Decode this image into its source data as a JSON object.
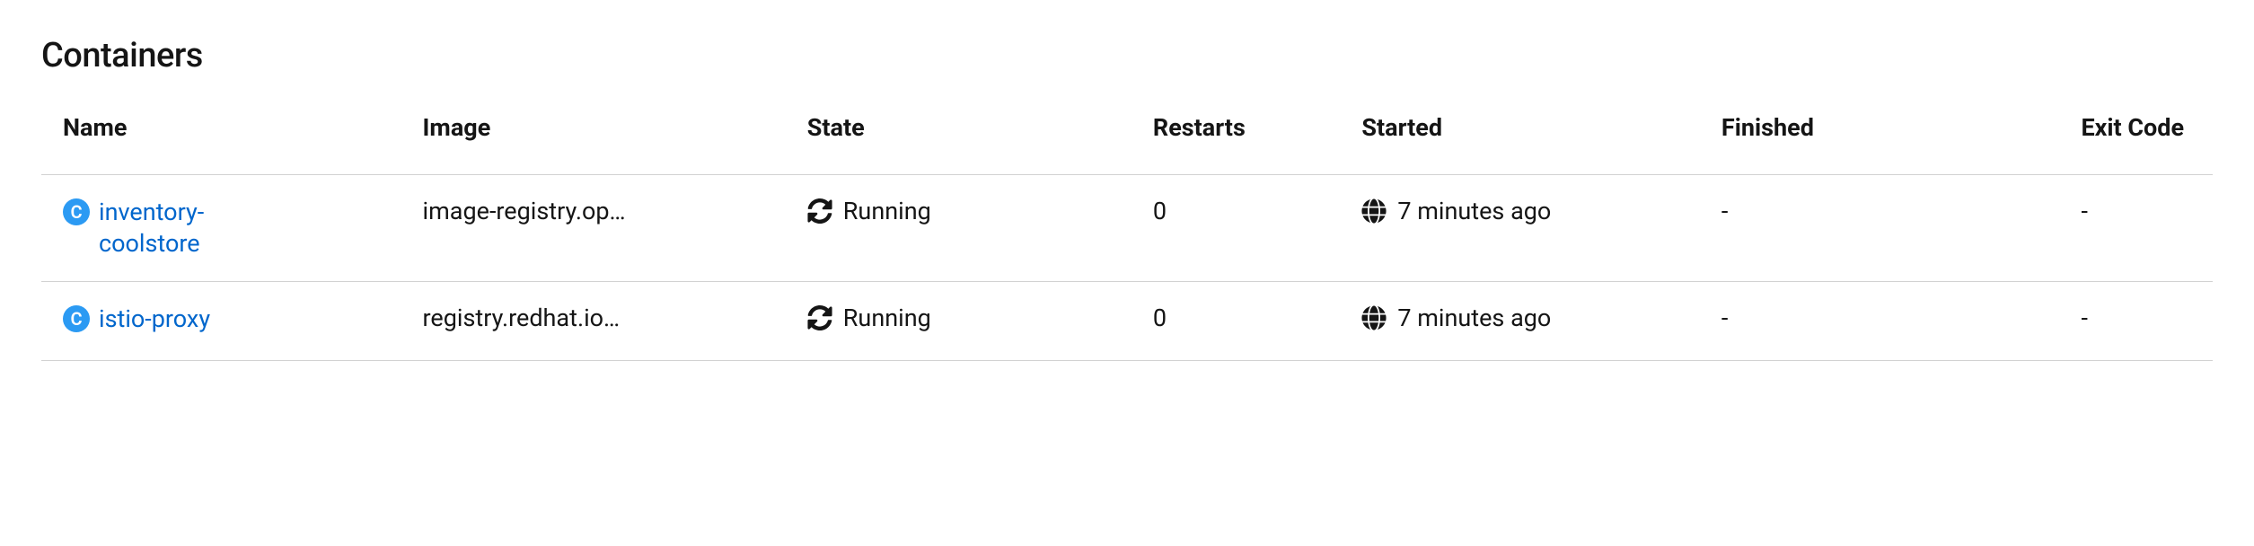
{
  "section": {
    "title": "Containers"
  },
  "table": {
    "headers": {
      "name": "Name",
      "image": "Image",
      "state": "State",
      "restarts": "Restarts",
      "started": "Started",
      "finished": "Finished",
      "exit_code": "Exit Code"
    },
    "rows": [
      {
        "badge": "C",
        "name": "inventory-coolstore",
        "image": "image-registry.ope…",
        "state": "Running",
        "restarts": "0",
        "started": "7 minutes ago",
        "finished": "-",
        "exit_code": "-"
      },
      {
        "badge": "C",
        "name": "istio-proxy",
        "image": "registry.redhat.io/o…",
        "state": "Running",
        "restarts": "0",
        "started": "7 minutes ago",
        "finished": "-",
        "exit_code": "-"
      }
    ]
  }
}
